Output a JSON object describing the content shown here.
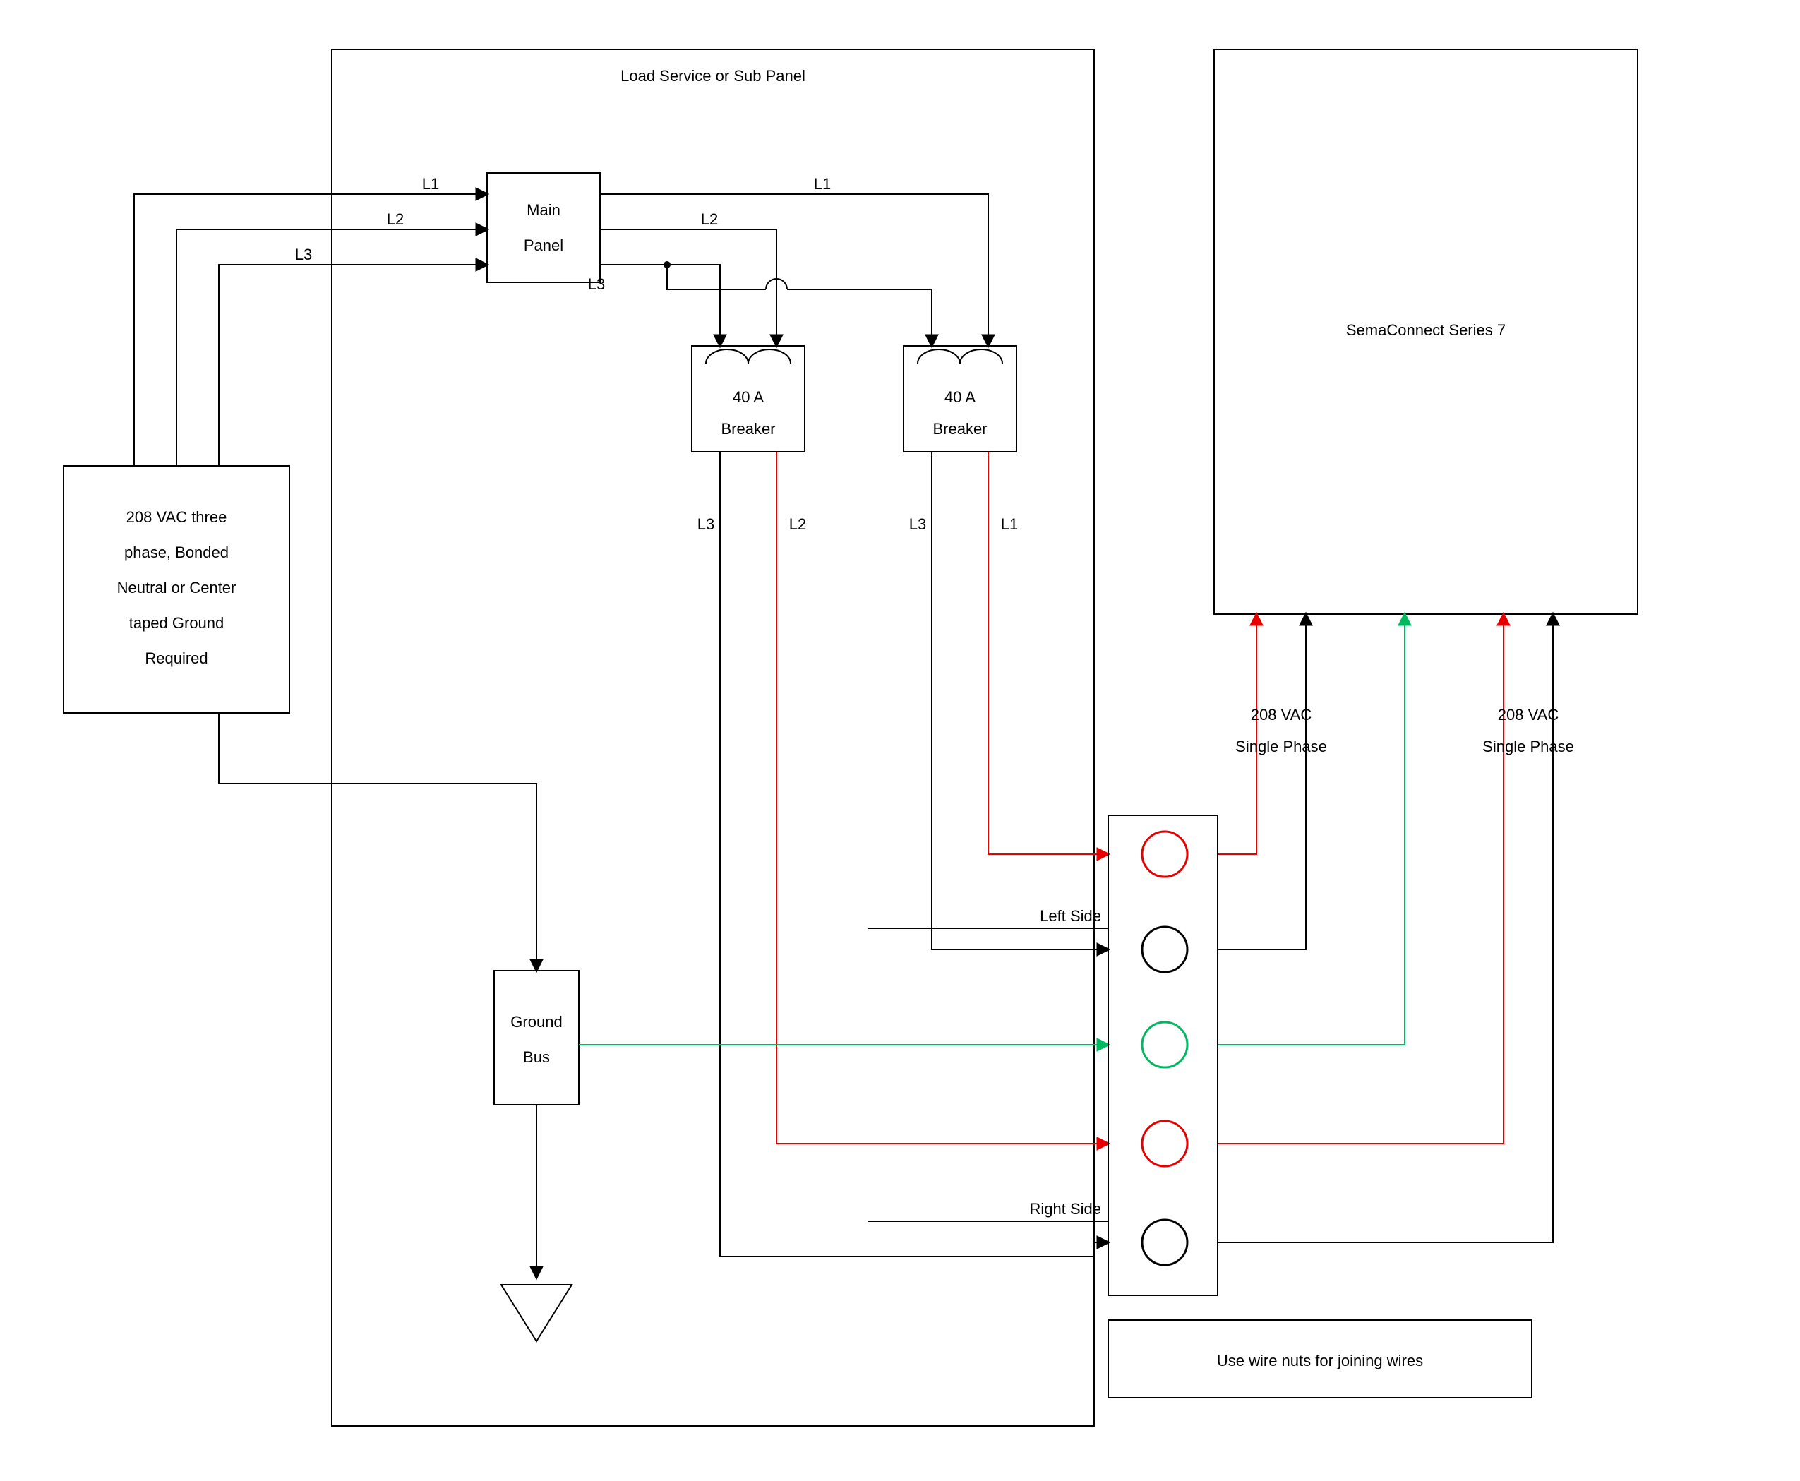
{
  "panel_title": "Load Service or Sub Panel",
  "supply": {
    "line1": "208 VAC three",
    "line2": "phase, Bonded",
    "line3": "Neutral or Center",
    "line4": "taped Ground",
    "line5": "Required"
  },
  "main_panel": {
    "line1": "Main",
    "line2": "Panel"
  },
  "breaker_left": {
    "rating": "40 A",
    "label": "Breaker"
  },
  "breaker_right": {
    "rating": "40 A",
    "label": "Breaker"
  },
  "phases_in": {
    "l1": "L1",
    "l2": "L2",
    "l3": "L3"
  },
  "phases_out_top": {
    "l1": "L1",
    "l2": "L2",
    "l3": "L3"
  },
  "breaker_left_out": {
    "left": "L3",
    "right": "L2"
  },
  "breaker_right_out": {
    "left": "L3",
    "right": "L1"
  },
  "ground_bus": {
    "line1": "Ground",
    "line2": "Bus"
  },
  "device": "SemaConnect Series 7",
  "junction": {
    "left_side": "Left Side",
    "right_side": "Right Side",
    "feed_left": {
      "line1": "208 VAC",
      "line2": "Single Phase"
    },
    "feed_right": {
      "line1": "208 VAC",
      "line2": "Single Phase"
    },
    "note": "Use wire nuts for joining wires"
  },
  "colors": {
    "red": "#e60000",
    "green": "#00b860",
    "black": "#000000"
  }
}
